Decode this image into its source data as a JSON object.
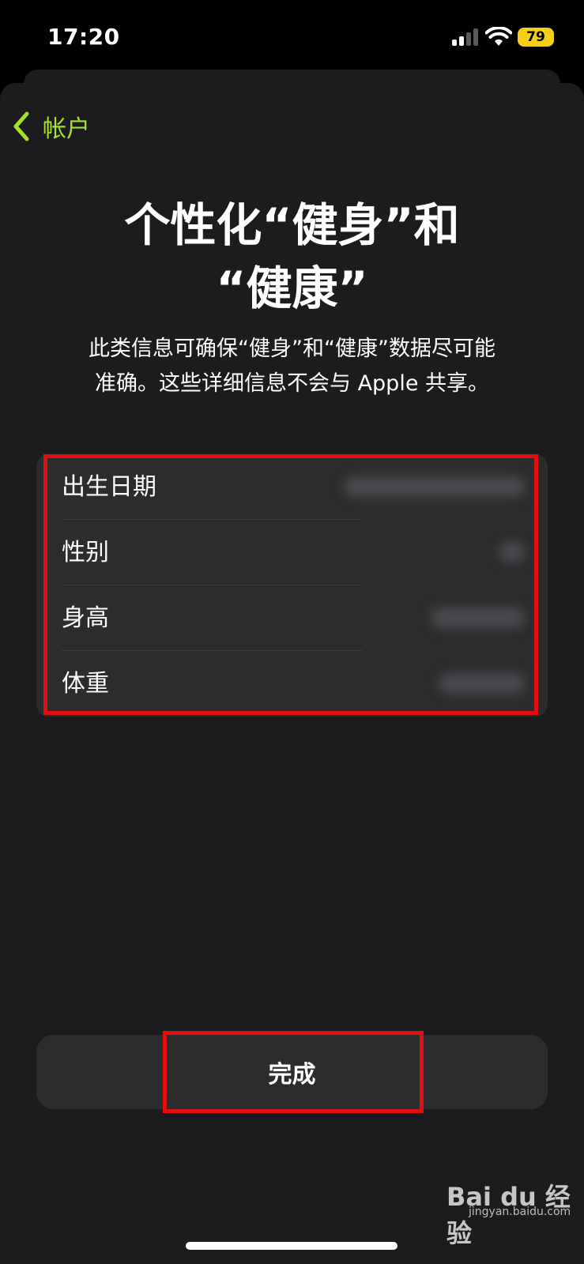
{
  "status_bar": {
    "time": "17:20",
    "battery": "79",
    "battery_color": "#f5cf17"
  },
  "nav": {
    "back_label": "帐户",
    "accent_color": "#a5e22b"
  },
  "title_lines": [
    "个性化“健身”和",
    "“健康”"
  ],
  "subtitle_lines": [
    "此类信息可确保“健身”和“健康”数据尽可能",
    "准确。这些详细信息不会与 Apple 共享。"
  ],
  "info_rows": [
    {
      "label": "出生日期"
    },
    {
      "label": "性别"
    },
    {
      "label": "身高"
    },
    {
      "label": "体重"
    }
  ],
  "done_label": "完成",
  "watermark": {
    "logo": "Bai du 经验",
    "url": "jingyan.baidu.com"
  }
}
